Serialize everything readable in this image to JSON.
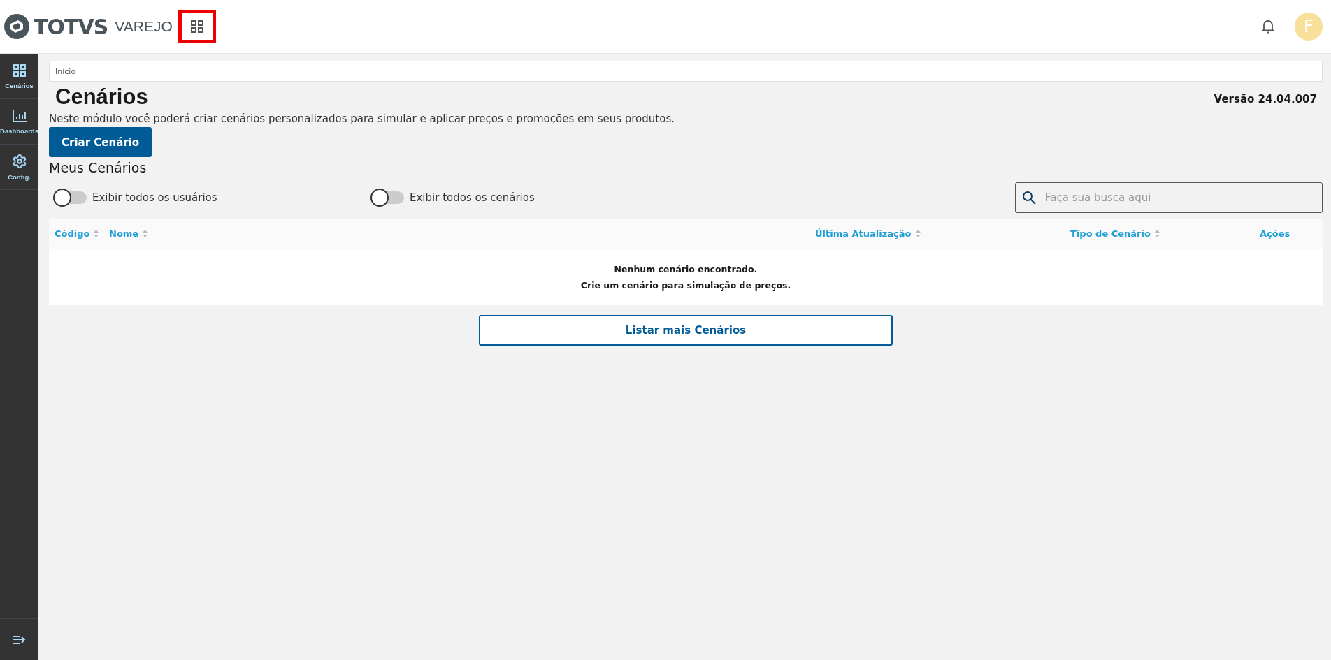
{
  "header": {
    "brand": "TOTVS",
    "product": "VAREJO",
    "apps_highlighted": true,
    "avatar": "F"
  },
  "sidebar": {
    "items": [
      {
        "label": "Cenários",
        "kind": "grid",
        "selected": true
      },
      {
        "label": "Dashboards",
        "kind": "chart",
        "selected": false
      },
      {
        "label": "Config.",
        "kind": "gear",
        "selected": false
      }
    ]
  },
  "breadcrumb": "Início",
  "title": "Cenários",
  "version": "Versão 24.04.007",
  "description": "Neste módulo você poderá criar cenários personalizados para simular e aplicar preços e promoções em seus produtos.",
  "create_button": "Criar Cenário",
  "section_title": "Meus Cenários",
  "toggles": [
    {
      "label": "Exibir todos os usuários",
      "on": false
    },
    {
      "label": "Exibir todos os cenários",
      "on": false
    }
  ],
  "search": {
    "placeholder": "Faça sua busca aqui"
  },
  "table": {
    "columns": [
      {
        "label": "Código",
        "sortable": true
      },
      {
        "label": "Nome",
        "sortable": true
      },
      {
        "label": "Última Atualização",
        "sortable": true
      },
      {
        "label": "Tipo de Cenário",
        "sortable": true
      },
      {
        "label": "Ações",
        "sortable": false
      }
    ],
    "empty_lines": [
      "Nenhum cenário encontrado.",
      "Crie um cenário para simulação de preços."
    ]
  },
  "more_button": "Listar mais Cenários"
}
